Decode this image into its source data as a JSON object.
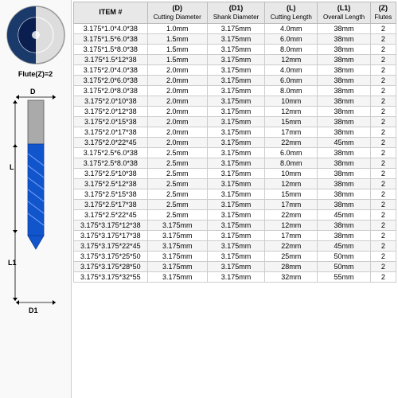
{
  "left": {
    "flute_label": "Flute(Z)=2",
    "dimensions": {
      "D": "D",
      "L": "L",
      "L1": "L1",
      "D1": "D1"
    }
  },
  "table": {
    "headers": {
      "item": "ITEM #",
      "D_label": "(D)",
      "D_sub": "Cutting Diameter",
      "D1_label": "(D1)",
      "D1_sub": "Shank Diameter",
      "L_label": "(L)",
      "L_sub": "Cutting Length",
      "L1_label": "(L1)",
      "L1_sub": "Overall Length",
      "Z_label": "(Z)",
      "Z_sub": "Flutes"
    },
    "rows": [
      [
        "3.175*1.0*4.0*38",
        "1.0mm",
        "3.175mm",
        "4.0mm",
        "38mm",
        "2"
      ],
      [
        "3.175*1.5*6.0*38",
        "1.5mm",
        "3.175mm",
        "6.0mm",
        "38mm",
        "2"
      ],
      [
        "3.175*1.5*8.0*38",
        "1.5mm",
        "3.175mm",
        "8.0mm",
        "38mm",
        "2"
      ],
      [
        "3.175*1.5*12*38",
        "1.5mm",
        "3.175mm",
        "12mm",
        "38mm",
        "2"
      ],
      [
        "3.175*2.0*4.0*38",
        "2.0mm",
        "3.175mm",
        "4.0mm",
        "38mm",
        "2"
      ],
      [
        "3.175*2.0*6.0*38",
        "2.0mm",
        "3.175mm",
        "6.0mm",
        "38mm",
        "2"
      ],
      [
        "3.175*2.0*8.0*38",
        "2.0mm",
        "3.175mm",
        "8.0mm",
        "38mm",
        "2"
      ],
      [
        "3.175*2.0*10*38",
        "2.0mm",
        "3.175mm",
        "10mm",
        "38mm",
        "2"
      ],
      [
        "3.175*2.0*12*38",
        "2.0mm",
        "3.175mm",
        "12mm",
        "38mm",
        "2"
      ],
      [
        "3.175*2.0*15*38",
        "2.0mm",
        "3.175mm",
        "15mm",
        "38mm",
        "2"
      ],
      [
        "3.175*2.0*17*38",
        "2.0mm",
        "3.175mm",
        "17mm",
        "38mm",
        "2"
      ],
      [
        "3.175*2.0*22*45",
        "2.0mm",
        "3.175mm",
        "22mm",
        "45mm",
        "2"
      ],
      [
        "3.175*2.5*6.0*38",
        "2.5mm",
        "3.175mm",
        "6.0mm",
        "38mm",
        "2"
      ],
      [
        "3.175*2.5*8.0*38",
        "2.5mm",
        "3.175mm",
        "8.0mm",
        "38mm",
        "2"
      ],
      [
        "3.175*2.5*10*38",
        "2.5mm",
        "3.175mm",
        "10mm",
        "38mm",
        "2"
      ],
      [
        "3.175*2.5*12*38",
        "2.5mm",
        "3.175mm",
        "12mm",
        "38mm",
        "2"
      ],
      [
        "3.175*2.5*15*38",
        "2.5mm",
        "3.175mm",
        "15mm",
        "38mm",
        "2"
      ],
      [
        "3.175*2.5*17*38",
        "2.5mm",
        "3.175mm",
        "17mm",
        "38mm",
        "2"
      ],
      [
        "3.175*2.5*22*45",
        "2.5mm",
        "3.175mm",
        "22mm",
        "45mm",
        "2"
      ],
      [
        "3.175*3.175*12*38",
        "3.175mm",
        "3.175mm",
        "12mm",
        "38mm",
        "2"
      ],
      [
        "3.175*3.175*17*38",
        "3.175mm",
        "3.175mm",
        "17mm",
        "38mm",
        "2"
      ],
      [
        "3.175*3.175*22*45",
        "3.175mm",
        "3.175mm",
        "22mm",
        "45mm",
        "2"
      ],
      [
        "3.175*3.175*25*50",
        "3.175mm",
        "3.175mm",
        "25mm",
        "50mm",
        "2"
      ],
      [
        "3.175*3.175*28*50",
        "3.175mm",
        "3.175mm",
        "28mm",
        "50mm",
        "2"
      ],
      [
        "3.175*3.175*32*55",
        "3.175mm",
        "3.175mm",
        "32mm",
        "55mm",
        "2"
      ]
    ]
  }
}
